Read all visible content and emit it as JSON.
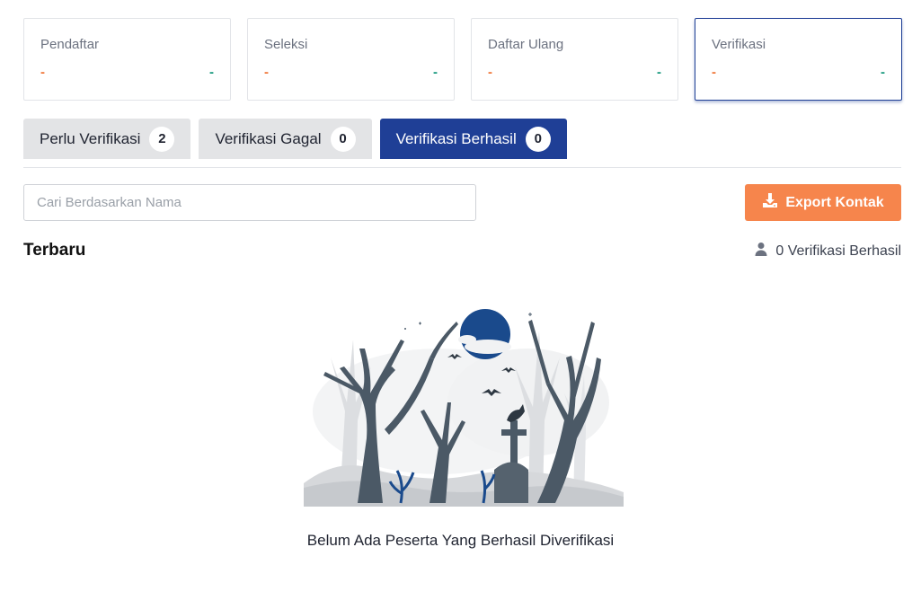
{
  "stats": [
    {
      "label": "Pendaftar",
      "left": "-",
      "right": "-",
      "active": false
    },
    {
      "label": "Seleksi",
      "left": "-",
      "right": "-",
      "active": false
    },
    {
      "label": "Daftar Ulang",
      "left": "-",
      "right": "-",
      "active": false
    },
    {
      "label": "Verifikasi",
      "left": "-",
      "right": "-",
      "active": true
    }
  ],
  "tabs": [
    {
      "label": "Perlu Verifikasi",
      "count": "2",
      "active": false
    },
    {
      "label": "Verifikasi Gagal",
      "count": "0",
      "active": false
    },
    {
      "label": "Verifikasi Berhasil",
      "count": "0",
      "active": true
    }
  ],
  "search": {
    "placeholder": "Cari Berdasarkan Nama",
    "value": ""
  },
  "export": {
    "label": "Export Kontak",
    "icon": "download-icon"
  },
  "section": {
    "title": "Terbaru",
    "count_text": "0 Verifikasi Berhasil",
    "count_icon": "user-icon"
  },
  "empty": {
    "message": "Belum Ada Peserta Yang Berhasil Diverifikasi",
    "illustration": "spooky-graveyard-illustration"
  },
  "colors": {
    "primary": "#1f3f96",
    "accent": "#f6854c",
    "orange_value": "#f0773a",
    "green_value": "#1a9a7f"
  }
}
